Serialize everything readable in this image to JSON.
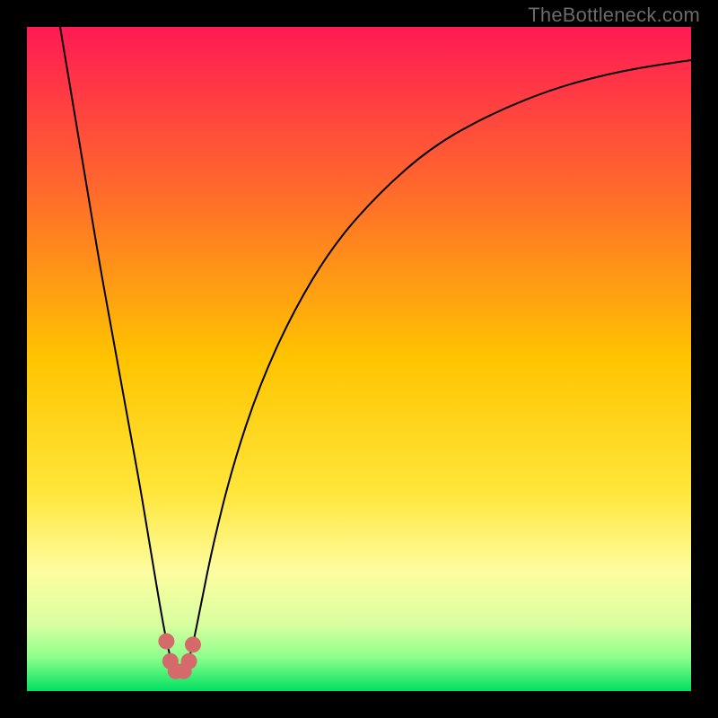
{
  "watermark": "TheBottleneck.com",
  "chart_data": {
    "type": "line",
    "title": "",
    "xlabel": "",
    "ylabel": "",
    "xlim": [
      0,
      100
    ],
    "ylim": [
      0,
      100
    ],
    "grid": false,
    "legend": false,
    "background_gradient": {
      "stops": [
        {
          "offset": 0.0,
          "color": "#ff1a54"
        },
        {
          "offset": 0.25,
          "color": "#ff6b2b"
        },
        {
          "offset": 0.5,
          "color": "#ffc400"
        },
        {
          "offset": 0.7,
          "color": "#ffe63a"
        },
        {
          "offset": 0.82,
          "color": "#fdfda0"
        },
        {
          "offset": 0.9,
          "color": "#d8ffa0"
        },
        {
          "offset": 0.95,
          "color": "#8cff8c"
        },
        {
          "offset": 1.0,
          "color": "#00e060"
        }
      ]
    },
    "series": [
      {
        "name": "curve",
        "color": "#000000",
        "width": 2,
        "x": [
          5,
          7,
          9,
          11,
          13,
          15,
          17,
          18,
          19,
          20,
          21,
          22,
          23,
          24,
          25,
          26,
          28,
          31,
          35,
          40,
          46,
          53,
          61,
          70,
          80,
          90,
          100
        ],
        "y": [
          100,
          88,
          76,
          64,
          53,
          42,
          31,
          25,
          19,
          13,
          7.5,
          3.5,
          3.0,
          3.5,
          7.0,
          12,
          22,
          34,
          46,
          57,
          67,
          75,
          82,
          87,
          91,
          93.5,
          95
        ]
      }
    ],
    "marker_cluster": {
      "name": "trough-markers",
      "color": "#d46a6a",
      "radius_px": 9,
      "points": [
        {
          "x": 21.0,
          "y": 7.5
        },
        {
          "x": 21.6,
          "y": 4.5
        },
        {
          "x": 22.4,
          "y": 3.0
        },
        {
          "x": 23.6,
          "y": 3.0
        },
        {
          "x": 24.4,
          "y": 4.5
        },
        {
          "x": 25.0,
          "y": 7.0
        }
      ]
    }
  }
}
